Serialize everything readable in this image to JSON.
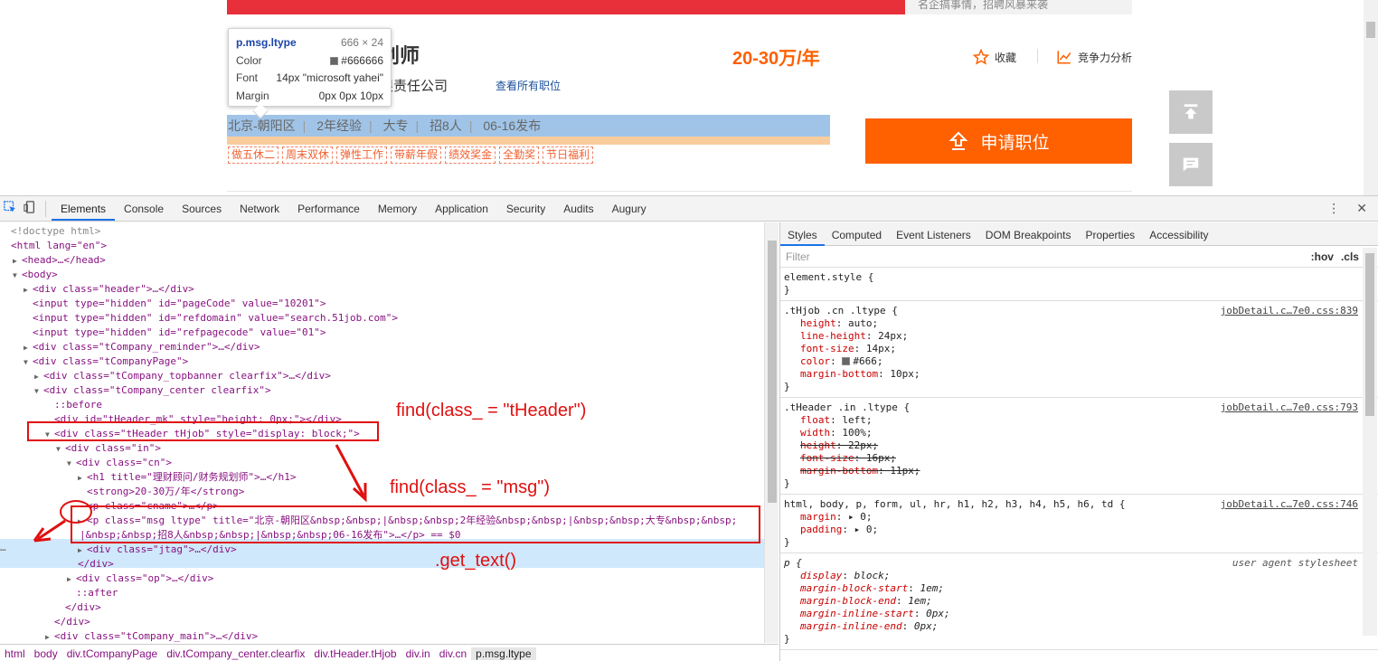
{
  "webpage": {
    "banner_right_text": "名企搞事情，招聘风暴来袭",
    "job_title_partial": "划师",
    "company_partial": "限责任公司",
    "all_jobs_link": "查看所有职位",
    "salary": "20-30万/年",
    "favorite_label": "收藏",
    "compete_label": "竞争力分析",
    "ltype_items": [
      "北京-朝阳区",
      "2年经验",
      "大专",
      "招8人",
      "06-16发布"
    ],
    "tags": [
      "做五休二",
      "周末双休",
      "弹性工作",
      "带薪年假",
      "绩效奖金",
      "全勤奖",
      "节日福利"
    ],
    "apply_label": "申请职位",
    "tooltip": {
      "selector": "p.msg.ltype",
      "size": "666 × 24",
      "color_label": "Color",
      "color_value": "#666666",
      "font_label": "Font",
      "font_value": "14px \"microsoft yahei\"",
      "margin_label": "Margin",
      "margin_value": "0px 0px 10px"
    }
  },
  "devtools": {
    "tabs": [
      "Elements",
      "Console",
      "Sources",
      "Network",
      "Performance",
      "Memory",
      "Application",
      "Security",
      "Audits",
      "Augury"
    ],
    "active_tab": "Elements",
    "dom_lines": [
      "<!doctype html>",
      "<html lang=\"en\">",
      "<head>…</head>",
      "<body>",
      "<div class=\"header\">…</div>",
      "<input type=\"hidden\" id=\"pageCode\" value=\"10201\">",
      "<input type=\"hidden\" id=\"refdomain\" value=\"search.51job.com\">",
      "<input type=\"hidden\" id=\"refpagecode\" value=\"01\">",
      "<div class=\"tCompany_reminder\">…</div>",
      "<div class=\"tCompanyPage\">",
      "<div class=\"tCompany_topbanner clearfix\">…</div>",
      "<div class=\"tCompany_center clearfix\">",
      "::before",
      "<div id=\"tHeader_mk\" style=\"height: 0px;\"></div>",
      "<div class=\"tHeader tHjob\" style=\"display: block;\">",
      "<div class=\"in\">",
      "<div class=\"cn\">",
      "<h1 title=\"理财顾问/财务规划师\">…</h1>",
      "<strong>20-30万/年</strong>",
      "<p class=\"cname\">…</p>",
      "<p class=\"msg ltype\" title=\"北京-朝阳区&nbsp;&nbsp;|&nbsp;&nbsp;2年经验&nbsp;&nbsp;|&nbsp;&nbsp;大专&nbsp;&nbsp;",
      "|&nbsp;&nbsp;招8人&nbsp;&nbsp;|&nbsp;&nbsp;06-16发布\">…</p> == $0",
      "<div class=\"jtag\">…</div>",
      "</div>",
      "<div class=\"op\">…</div>",
      "::after",
      "</div>",
      "</div>",
      "<div class=\"tCompany_main\">…</div>"
    ],
    "breadcrumbs": [
      "html",
      "body",
      "div.tCompanyPage",
      "div.tCompany_center.clearfix",
      "div.tHeader.tHjob",
      "div.in",
      "div.cn",
      "p.msg.ltype"
    ],
    "styles_tabs": [
      "Styles",
      "Computed",
      "Event Listeners",
      "DOM Breakpoints",
      "Properties",
      "Accessibility"
    ],
    "filter_placeholder": "Filter",
    "filter_hov": ":hov",
    "filter_cls": ".cls",
    "rules": [
      {
        "selector": "element.style {",
        "source": "",
        "decls": [],
        "close": "}"
      },
      {
        "selector": ".tHjob .cn .ltype {",
        "source": "jobDetail.c…7e0.css:839",
        "decls": [
          {
            "p": "height",
            "v": "auto;",
            "strike": false
          },
          {
            "p": "line-height",
            "v": "24px;",
            "strike": false
          },
          {
            "p": "font-size",
            "v": "14px;",
            "strike": false
          },
          {
            "p": "color",
            "v": "#666;",
            "strike": false,
            "swatch": "#666666"
          },
          {
            "p": "margin-bottom",
            "v": "10px;",
            "strike": false
          }
        ],
        "close": "}"
      },
      {
        "selector": ".tHeader .in .ltype {",
        "source": "jobDetail.c…7e0.css:793",
        "decls": [
          {
            "p": "float",
            "v": "left;",
            "strike": false
          },
          {
            "p": "width",
            "v": "100%;",
            "strike": false
          },
          {
            "p": "height",
            "v": "22px;",
            "strike": true
          },
          {
            "p": "font-size",
            "v": "16px;",
            "strike": true
          },
          {
            "p": "margin-bottom",
            "v": "11px;",
            "strike": true
          }
        ],
        "close": "}"
      },
      {
        "selector": "html, body, p, form, ul, hr, h1, h2, h3, h4, h5, h6, td {",
        "source": "jobDetail.c…7e0.css:746",
        "decls": [
          {
            "p": "margin",
            "v": "▸ 0;",
            "strike": false
          },
          {
            "p": "padding",
            "v": "▸ 0;",
            "strike": false
          }
        ],
        "close": "}"
      },
      {
        "selector": "p {",
        "source": "user agent stylesheet",
        "ua": true,
        "decls": [
          {
            "p": "display",
            "v": "block;",
            "strike": false
          },
          {
            "p": "margin-block-start",
            "v": "1em;",
            "strike": false
          },
          {
            "p": "margin-block-end",
            "v": "1em;",
            "strike": false
          },
          {
            "p": "margin-inline-start",
            "v": "0px;",
            "strike": false
          },
          {
            "p": "margin-inline-end",
            "v": "0px;",
            "strike": false
          }
        ],
        "close": "}"
      }
    ]
  },
  "annotations": {
    "find_theader": "find(class_ = \"tHeader\")",
    "find_msg": "find(class_ = \"msg\")",
    "get_text": ".get_text()"
  },
  "colors": {
    "accent_orange": "#ff6000",
    "annotation_red": "#e01010",
    "devtools_blue": "#1a73e8"
  }
}
